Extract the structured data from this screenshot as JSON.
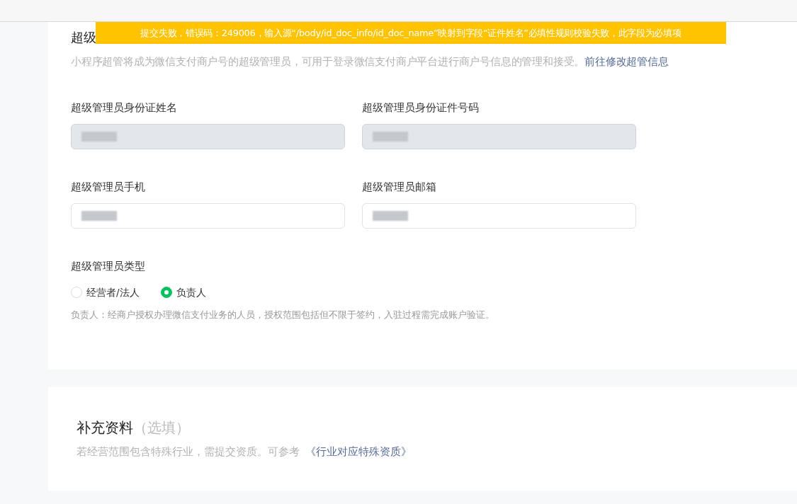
{
  "toast": {
    "message": "提交失败，错误码：249006，输入源“/body/id_doc_info/id_doc_name”映射到字段“证件姓名”必填性规则校验失败，此字段为必填项"
  },
  "admin_section": {
    "title": "超级",
    "description": "小程序超管将成为微信支付商户号的超级管理员，可用于登录微信支付商户平台进行商户号信息的管理和接受。",
    "link": "前往修改超管信息",
    "fields": [
      {
        "label": "超级管理员身份证姓名",
        "disabled": true
      },
      {
        "label": "超级管理员身份证件号码",
        "disabled": true
      },
      {
        "label": "超级管理员手机",
        "disabled": false
      },
      {
        "label": "超级管理员邮箱",
        "disabled": false
      }
    ],
    "type_label": "超级管理员类型",
    "type_options": [
      {
        "label": "经营者/法人",
        "selected": false
      },
      {
        "label": "负责人",
        "selected": true
      }
    ],
    "type_note": "负责人：经商户授权办理微信支付业务的人员，授权范围包括但不限于签约，入驻过程需完成账户验证。"
  },
  "extra_section": {
    "title": "补充资料",
    "optional_mark": "（选填）",
    "description": "若经营范围包含特殊行业，需提交资质。可参考",
    "link": "《行业对应特殊资质》"
  }
}
